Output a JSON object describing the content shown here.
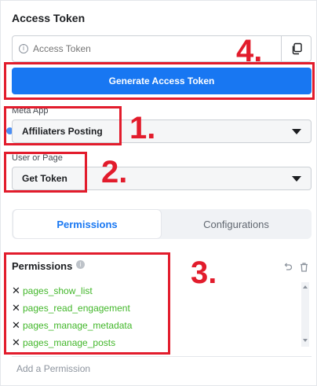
{
  "panel": {
    "title": "Access Token"
  },
  "token": {
    "placeholder": "Access Token",
    "info_icon": "info-icon",
    "copy_icon": "copy-icon"
  },
  "generate_button": {
    "label": "Generate Access Token",
    "color": "#1877f2"
  },
  "meta_app": {
    "label": "Meta App",
    "value": "Affiliaters Posting"
  },
  "user_or_page": {
    "label": "User or Page",
    "value": "Get Token"
  },
  "tabs": [
    {
      "label": "Permissions",
      "active": true
    },
    {
      "label": "Configurations",
      "active": false
    }
  ],
  "permissions": {
    "title": "Permissions",
    "items": [
      {
        "name": "pages_show_list"
      },
      {
        "name": "pages_read_engagement"
      },
      {
        "name": "pages_manage_metadata"
      },
      {
        "name": "pages_manage_posts"
      }
    ],
    "add_placeholder": "Add a Permission",
    "item_color": "#42b72a"
  },
  "annotations": [
    {
      "number": "1."
    },
    {
      "number": "2."
    },
    {
      "number": "3."
    },
    {
      "number": "4."
    }
  ],
  "annotation_color": "#e21c2c"
}
